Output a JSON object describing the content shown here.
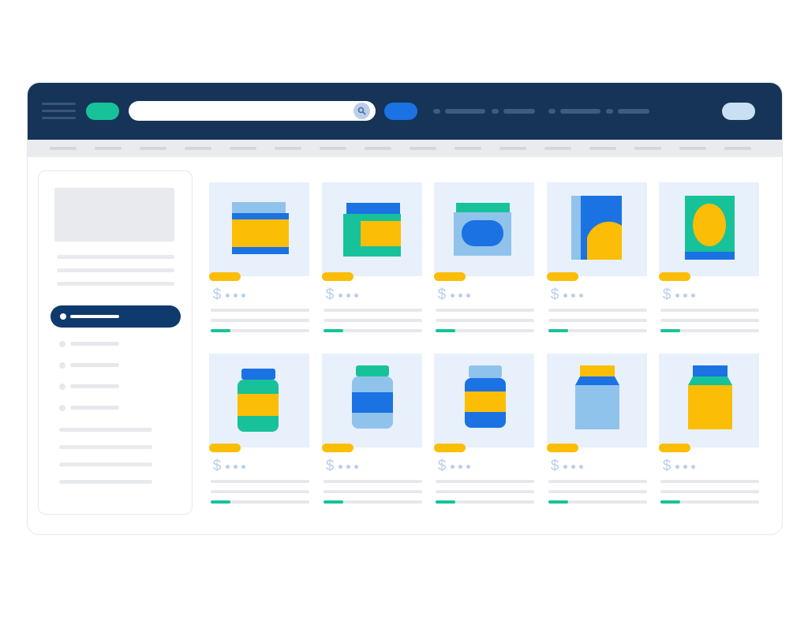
{
  "colors": {
    "navy": "#163457",
    "teal": "#17c29a",
    "blue": "#1b72e3",
    "light_blue": "#90c3ec",
    "yellow": "#fbbd06",
    "pale_blue": "#e8f0fb",
    "gray": "#e8eaed",
    "account": "#c9e0f4",
    "pill": "#0f3a6d"
  },
  "header": {
    "menu_icon": "hamburger-menu-icon",
    "search_icon": "magnifier-icon"
  },
  "products": [
    {
      "name": "jar-wide",
      "currency": "$",
      "rating": 0.2
    },
    {
      "name": "box-window",
      "currency": "$",
      "rating": 0.2
    },
    {
      "name": "tin-oval",
      "currency": "$",
      "rating": 0.2
    },
    {
      "name": "book-box",
      "currency": "$",
      "rating": 0.2
    },
    {
      "name": "card-pack",
      "currency": "$",
      "rating": 0.2
    },
    {
      "name": "bottle-teal",
      "currency": "$",
      "rating": 0.2
    },
    {
      "name": "bottle-light",
      "currency": "$",
      "rating": 0.2
    },
    {
      "name": "bottle-blue",
      "currency": "$",
      "rating": 0.2
    },
    {
      "name": "carton-blue",
      "currency": "$",
      "rating": 0.2
    },
    {
      "name": "carton-yellow",
      "currency": "$",
      "rating": 0.2
    }
  ]
}
